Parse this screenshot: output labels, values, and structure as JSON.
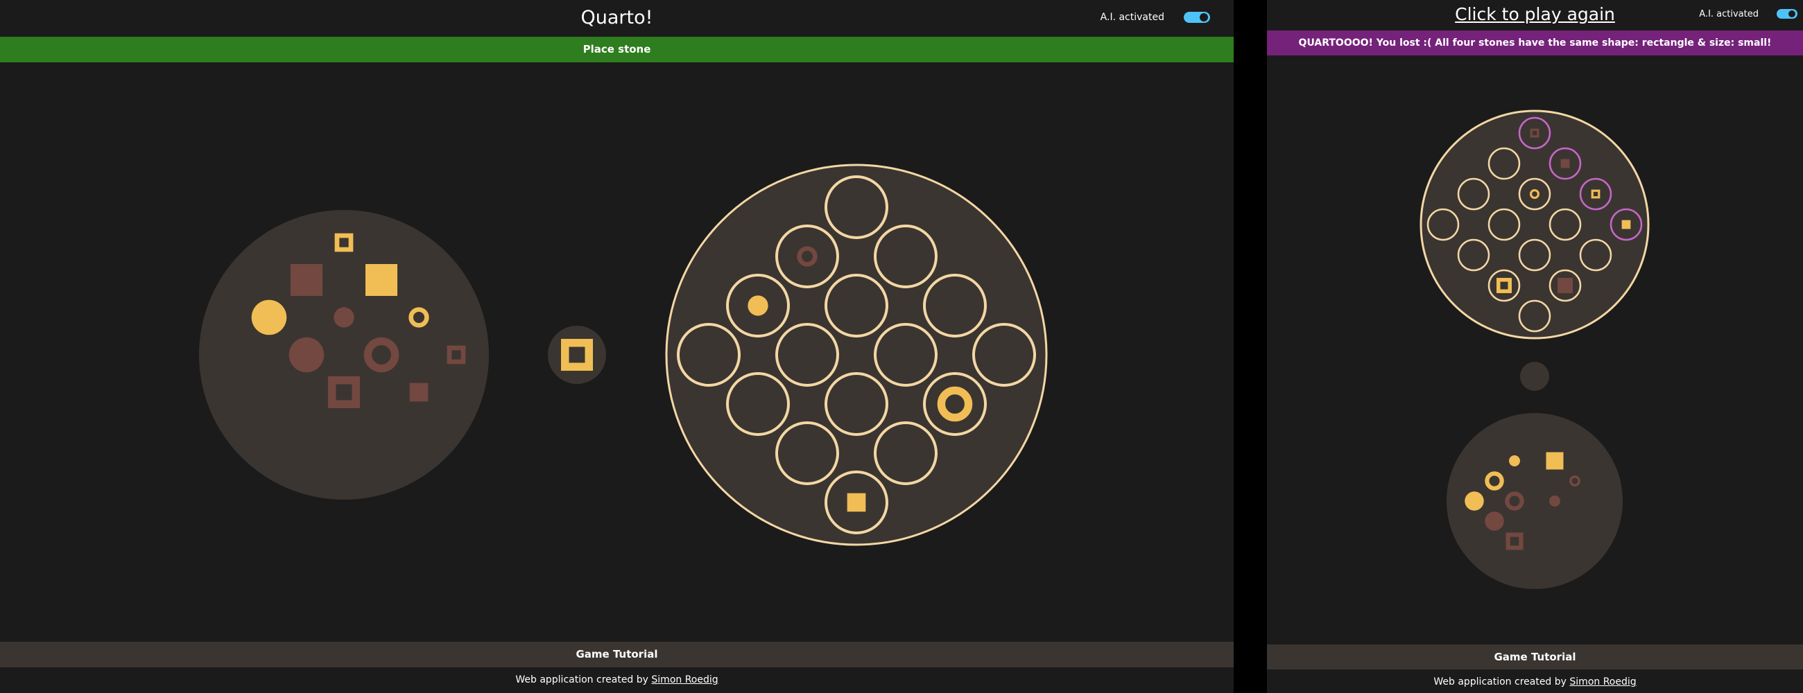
{
  "left": {
    "title": "Quarto!",
    "ai_label": "A.I. activated",
    "status": "Place stone",
    "tutorial": "Game Tutorial",
    "credits_prefix": "Web application created by",
    "credits_link": "Simon Roedig"
  },
  "right": {
    "replay": "Click to play again",
    "ai_label": "A.I. activated",
    "status": "QUARTOOOO! You lost :( All four stones have the same shape: rectangle & size: small!",
    "tutorial": "Game Tutorial",
    "credits_prefix": "Web application created by",
    "credits_link": "Simon Roedig"
  },
  "colors": {
    "background": "#1b1b1b",
    "panel": "#3b3531",
    "board_outline": "#f3d7a4",
    "light_piece": "#f0be55",
    "dark_piece": "#734840",
    "status_green": "#2e7d1f",
    "status_purple": "#74227a",
    "win_highlight": "#c667c9",
    "toggle": "#4fc3f7"
  },
  "board_left": [
    {
      "pos": "A1",
      "piece": null
    },
    {
      "pos": "A2",
      "piece": null
    },
    {
      "pos": "A3",
      "piece": null
    },
    {
      "pos": "A4",
      "piece": null
    },
    {
      "pos": "B1",
      "piece": {
        "color": "dark",
        "shape": "circle",
        "size": "small",
        "hollow": true
      }
    },
    {
      "pos": "B2",
      "piece": null
    },
    {
      "pos": "B3",
      "piece": null
    },
    {
      "pos": "B4",
      "piece": {
        "color": "light",
        "shape": "circle",
        "size": "large",
        "hollow": true
      }
    },
    {
      "pos": "C1",
      "piece": {
        "color": "light",
        "shape": "circle",
        "size": "small",
        "hollow": false
      }
    },
    {
      "pos": "C2",
      "piece": null
    },
    {
      "pos": "C3",
      "piece": null
    },
    {
      "pos": "C4",
      "piece": null
    },
    {
      "pos": "D1",
      "piece": null
    },
    {
      "pos": "D2",
      "piece": null
    },
    {
      "pos": "D3",
      "piece": null
    },
    {
      "pos": "D4",
      "piece": {
        "color": "light",
        "shape": "square",
        "size": "small",
        "hollow": false
      }
    }
  ],
  "selected_left": {
    "color": "light",
    "shape": "square",
    "size": "large",
    "hollow": true
  },
  "pool_left": [
    {
      "color": "light",
      "shape": "square",
      "size": "small",
      "hollow": true
    },
    {
      "color": "light",
      "shape": "square",
      "size": "large",
      "hollow": false
    },
    {
      "color": "dark",
      "shape": "square",
      "size": "large",
      "hollow": false
    },
    {
      "color": "light",
      "shape": "circle",
      "size": "small",
      "hollow": true
    },
    {
      "color": "dark",
      "shape": "circle",
      "size": "small",
      "hollow": false
    },
    {
      "color": "light",
      "shape": "circle",
      "size": "large",
      "hollow": false
    },
    {
      "color": "dark",
      "shape": "circle",
      "size": "large",
      "hollow": true
    },
    {
      "color": "dark",
      "shape": "square",
      "size": "small",
      "hollow": true
    },
    {
      "color": "dark",
      "shape": "circle",
      "size": "large",
      "hollow": false
    },
    {
      "color": "dark",
      "shape": "square",
      "size": "small",
      "hollow": false
    },
    {
      "color": "dark",
      "shape": "square",
      "size": "large",
      "hollow": true
    }
  ],
  "board_right": [
    {
      "pos": "A1",
      "piece": {
        "color": "dark",
        "shape": "square",
        "size": "small",
        "hollow": true
      },
      "win": true
    },
    {
      "pos": "A2",
      "piece": {
        "color": "dark",
        "shape": "square",
        "size": "small",
        "hollow": false
      },
      "win": true
    },
    {
      "pos": "A3",
      "piece": {
        "color": "light",
        "shape": "square",
        "size": "small",
        "hollow": true
      },
      "win": true
    },
    {
      "pos": "A4",
      "piece": {
        "color": "light",
        "shape": "square",
        "size": "small",
        "hollow": false
      },
      "win": true
    },
    {
      "pos": "B1",
      "piece": null,
      "win": false
    },
    {
      "pos": "B2",
      "piece": {
        "color": "light",
        "shape": "circle",
        "size": "small",
        "hollow": true
      },
      "win": false
    },
    {
      "pos": "B3",
      "piece": null,
      "win": false
    },
    {
      "pos": "B4",
      "piece": null,
      "win": false
    },
    {
      "pos": "C1",
      "piece": null,
      "win": false
    },
    {
      "pos": "C2",
      "piece": null,
      "win": false
    },
    {
      "pos": "C3",
      "piece": null,
      "win": false
    },
    {
      "pos": "C4",
      "piece": {
        "color": "dark",
        "shape": "square",
        "size": "large",
        "hollow": false
      },
      "win": false
    },
    {
      "pos": "D1",
      "piece": null,
      "win": false
    },
    {
      "pos": "D2",
      "piece": null,
      "win": false
    },
    {
      "pos": "D3",
      "piece": {
        "color": "light",
        "shape": "square",
        "size": "large",
        "hollow": true
      },
      "win": false
    },
    {
      "pos": "D4",
      "piece": null,
      "win": false
    }
  ],
  "pool_right": [
    {
      "color": "light",
      "shape": "square",
      "size": "large",
      "hollow": false
    },
    {
      "color": "light",
      "shape": "circle",
      "size": "small",
      "hollow": false
    },
    {
      "color": "dark",
      "shape": "circle",
      "size": "small",
      "hollow": true
    },
    {
      "color": "light",
      "shape": "circle",
      "size": "large",
      "hollow": true
    },
    {
      "color": "dark",
      "shape": "circle",
      "size": "small",
      "hollow": false
    },
    {
      "color": "light",
      "shape": "circle",
      "size": "large",
      "hollow": false
    },
    {
      "color": "dark",
      "shape": "circle",
      "size": "large",
      "hollow": true
    },
    {
      "color": "dark",
      "shape": "circle",
      "size": "large",
      "hollow": false
    },
    {
      "color": "dark",
      "shape": "square",
      "size": "large",
      "hollow": true
    }
  ]
}
